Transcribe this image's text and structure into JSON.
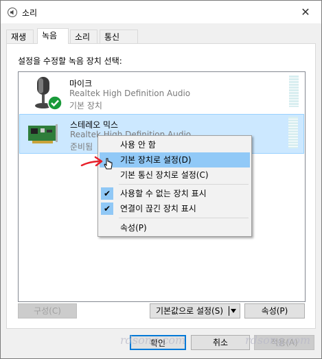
{
  "window": {
    "title": "소리",
    "close_glyph": "✕"
  },
  "tabs": [
    {
      "label": "재생"
    },
    {
      "label": "녹음"
    },
    {
      "label": "소리"
    },
    {
      "label": "통신"
    }
  ],
  "instruction": "설정을 수정할 녹음 장치 선택:",
  "devices": [
    {
      "name": "마이크",
      "driver": "Realtek High Definition Audio",
      "status": "기본 장치",
      "icon": "microphone-icon",
      "default": true
    },
    {
      "name": "스테레오 믹스",
      "driver": "Realtek High Definition Audio",
      "status": "준비됨",
      "icon": "sound-card-icon",
      "selected": true
    }
  ],
  "context_menu": {
    "items": [
      {
        "label": "사용 안 함"
      },
      {
        "label": "기본 장치로 설정(D)",
        "highlighted": true
      },
      {
        "label": "기본 통신 장치로 설정(C)"
      },
      {
        "label": "사용할 수 없는 장치 표시",
        "checked": true
      },
      {
        "label": "연결이 끊긴 장치 표시",
        "checked": true
      },
      {
        "label": "속성(P)"
      }
    ]
  },
  "buttons": {
    "configure": "구성(C)",
    "set_default": "기본값으로 설정(S)",
    "properties": "속성(P)",
    "ok": "확인",
    "cancel": "취소",
    "apply": "적용(A)"
  },
  "watermark": "rdsong.com",
  "colors": {
    "selection": "#cce8ff",
    "menu_highlight": "#91c9f7",
    "check_green": "#1a9a3a",
    "arrow_red": "#e8202a"
  }
}
